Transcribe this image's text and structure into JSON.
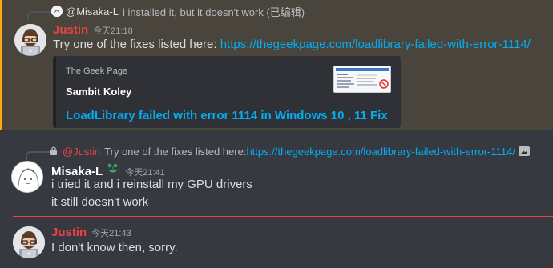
{
  "messages": [
    {
      "reply": {
        "name": "@Misaka-L",
        "text": "i installed it, but it doesn't work (已编辑)"
      },
      "author": "Justin",
      "timestamp": "今天21:18",
      "content_prefix": "Try one of the fixes listed here: ",
      "content_link": "https://thegeekpage.com/loadlibrary-failed-with-error-1114/",
      "embed": {
        "provider": "The Geek Page",
        "author": "Sambit Koley",
        "title": "LoadLibrary failed with error 1114 in Windows 10 , 11 Fix"
      }
    },
    {
      "reply": {
        "name": "@Justin",
        "text_prefix": "Try one of the fixes listed here: ",
        "text_link": "https://thegeekpage.com/loadlibrary-failed-with-error-1114/"
      },
      "author": "Misaka-L",
      "timestamp": "今天21:41",
      "lines": [
        "i tried it and i reinstall my GPU drivers",
        "it still doesn't work"
      ]
    },
    {
      "author": "Justin",
      "timestamp": "今天21:43",
      "content": "I don't know then, sorry."
    }
  ],
  "colors": {
    "background": "#36393f",
    "highlight": "#49443c",
    "highlight_bar": "#faa81a",
    "link": "#00aff4",
    "justin": "#ed4245",
    "new_divider": "#ed4245"
  }
}
